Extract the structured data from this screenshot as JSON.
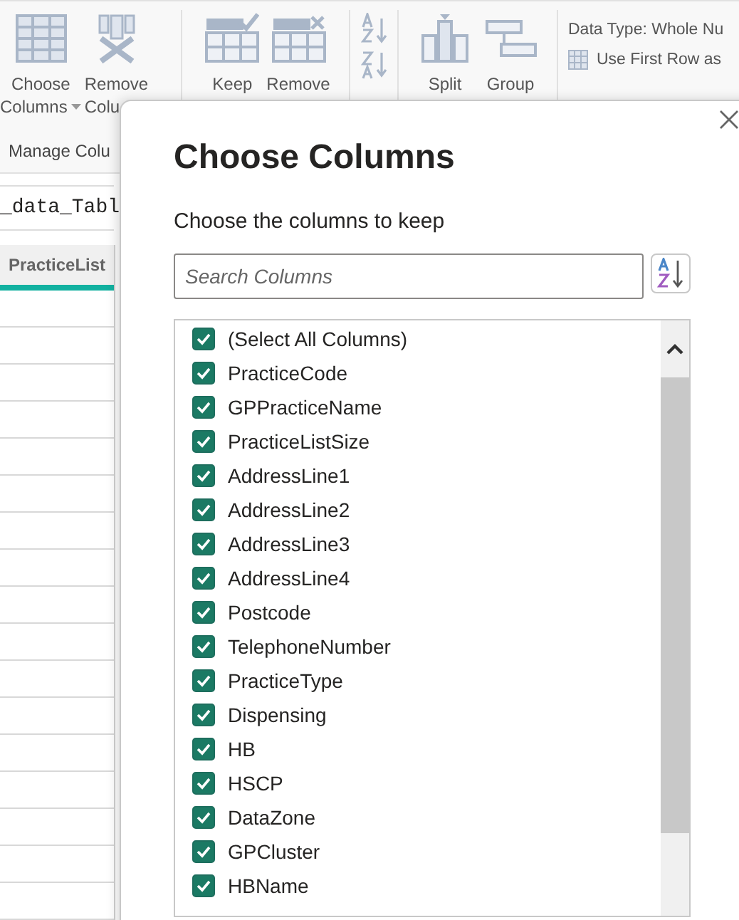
{
  "ribbon": {
    "groups": [
      {
        "label": "Manage Colu",
        "buttons": [
          {
            "kind": "choose",
            "lines": [
              "Choose",
              "Columns"
            ],
            "dropdown": true
          },
          {
            "kind": "remove",
            "lines": [
              "Remove",
              "Colu"
            ],
            "dropdown": false
          }
        ]
      },
      {
        "buttons": [
          {
            "kind": "keep",
            "lines": [
              "Keep"
            ],
            "dropdown": false
          },
          {
            "kind": "removerows",
            "lines": [
              "Remove"
            ],
            "dropdown": false
          }
        ]
      },
      {
        "buttons": [
          {
            "kind": "sort",
            "dropdown": false
          }
        ]
      },
      {
        "buttons": [
          {
            "kind": "split",
            "lines": [
              "Split"
            ],
            "dropdown": false
          },
          {
            "kind": "group",
            "lines": [
              "Group"
            ],
            "dropdown": false
          }
        ]
      }
    ],
    "side_items": [
      {
        "kind": "text",
        "label": "Data Type: Whole Nu"
      },
      {
        "kind": "grid",
        "label": "Use First Row as"
      }
    ]
  },
  "query_name": "_data_Tabl",
  "table": {
    "columns": [
      "PracticeList"
    ]
  },
  "dialog": {
    "title": "Choose Columns",
    "subtitle": "Choose the columns to keep",
    "search": {
      "placeholder": "Search Columns"
    },
    "items": [
      {
        "label": "(Select All Columns)",
        "checked": true
      },
      {
        "label": "PracticeCode",
        "checked": true
      },
      {
        "label": "GPPracticeName",
        "checked": true
      },
      {
        "label": "PracticeListSize",
        "checked": true
      },
      {
        "label": "AddressLine1",
        "checked": true
      },
      {
        "label": "AddressLine2",
        "checked": true
      },
      {
        "label": "AddressLine3",
        "checked": true
      },
      {
        "label": "AddressLine4",
        "checked": true
      },
      {
        "label": "Postcode",
        "checked": true
      },
      {
        "label": "TelephoneNumber",
        "checked": true
      },
      {
        "label": "PracticeType",
        "checked": true
      },
      {
        "label": "Dispensing",
        "checked": true
      },
      {
        "label": "HB",
        "checked": true
      },
      {
        "label": "HSCP",
        "checked": true
      },
      {
        "label": "DataZone",
        "checked": true
      },
      {
        "label": "GPCluster",
        "checked": true
      },
      {
        "label": "HBName",
        "checked": true
      }
    ]
  }
}
